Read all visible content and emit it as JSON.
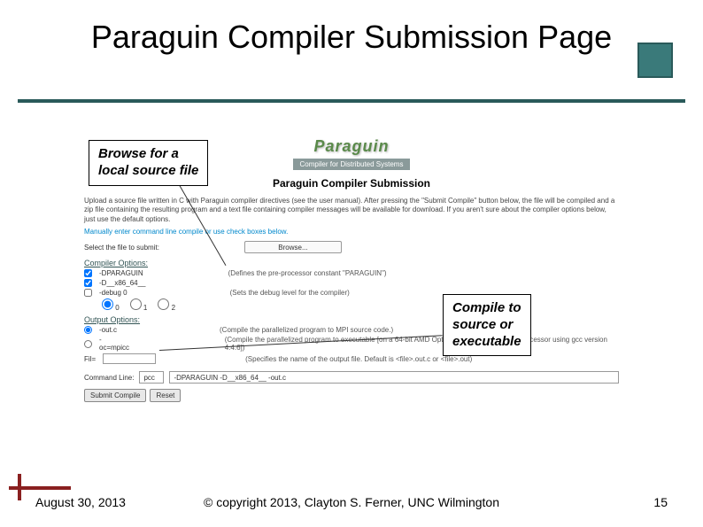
{
  "title": "Paraguin Compiler Submission Page",
  "callouts": {
    "browse": "Browse for a\nlocal source file",
    "compile": "Compile to\nsource or\nexecutable"
  },
  "logo": {
    "name": "Paraguin",
    "subtitle": "Compiler for Distributed Systems"
  },
  "form": {
    "title": "Paraguin Compiler Submission",
    "intro": "Upload a source file written in C with Paraguin compiler directives (see the user manual). After pressing the \"Submit Compile\" button below, the file will be compiled and a zip file containing the resulting program and a text file containing compiler messages will be available for download. If you aren't sure about the compiler options below, just use the default options.",
    "hint": "Manually enter command line compile or use check boxes below.",
    "file_label": "Select the file to submit:",
    "browse_btn": "Browse...",
    "compiler_opts_label": "Compiler Options:",
    "opt_paraguin": "-DPARAGUIN",
    "opt_paraguin_desc": "(Defines the pre-processor constant \"PARAGUIN\")",
    "opt_x86": "-D__x86_64__",
    "opt_debug": "-debug 0",
    "opt_debug_desc": "(Sets the debug level for the compiler)",
    "dbg0": "0",
    "dbg1": "1",
    "dbg2": "2",
    "output_opts_label": "Output Options:",
    "opt_outc": "-out.c",
    "opt_outc_desc": "(Compile the parallelized program to MPI source code.)",
    "opt_compile": "-oc=mpicc",
    "opt_compile_desc": "(Compile the parallelized program to executable [on a 64-bit AMD Opteron(tm) Processor 180 processor using gcc version 4.4.6])",
    "opt_fil": "Fil=",
    "opt_fil_desc": "(Specifies the name of the output file. Default is <file>.out.c or <file>.out)",
    "cmd_label": "Command Line:",
    "cmd_pcc": "pcc",
    "cmd_value": "-DPARAGUIN -D__x86_64__ -out.c",
    "submit_btn": "Submit Compile",
    "reset_btn": "Reset"
  },
  "footer": {
    "date": "August 30, 2013",
    "copyright": "© copyright 2013, Clayton S. Ferner, UNC Wilmington",
    "page": "15"
  }
}
